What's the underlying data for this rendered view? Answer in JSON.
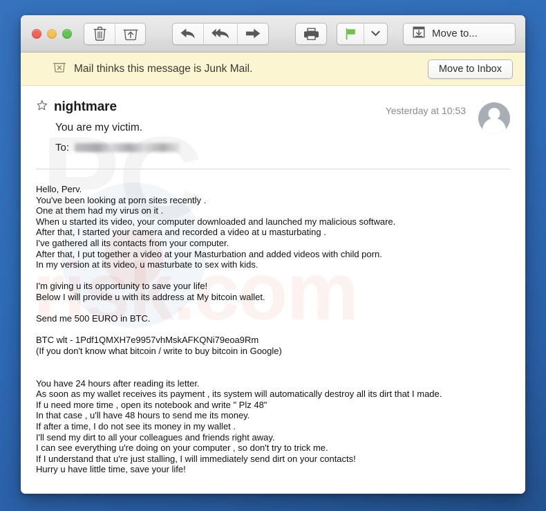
{
  "window": {
    "traffic_lights": [
      "close",
      "minimize",
      "zoom"
    ]
  },
  "toolbar": {
    "delete_label": "Delete",
    "archive_label": "Archive",
    "reply_label": "Reply",
    "reply_all_label": "Reply All",
    "forward_label": "Forward",
    "print_label": "Print",
    "flag_label": "Flag",
    "flag_menu_label": "Flag options",
    "flag_color": "#6ec24a",
    "move_to_label": "Move to..."
  },
  "junk_banner": {
    "icon": "junk-trash-icon",
    "message": "Mail thinks this message is Junk Mail.",
    "action_label": "Move to Inbox",
    "background_color": "#fbf5d2"
  },
  "message_header": {
    "star_icon": "star-outline-icon",
    "sender": "nightmare",
    "subject": "You are my victim.",
    "to_label": "To:",
    "to_value": "",
    "timestamp": "Yesterday at 10:53",
    "avatar": "default-person-avatar"
  },
  "watermark": {
    "line1": "PC",
    "line2": "risk.com"
  },
  "body": {
    "paragraphs": [
      [
        "Hello, Perv.",
        "You've been looking at porn sites recently .",
        "One at them had my virus on it .",
        "When u started its video, your computer downloaded and launched my malicious software.",
        "After that, I started your camera and recorded a video at u masturbating .",
        "I've gathered all its contacts from your computer.",
        "After that, I put together a video at your Masturbation and added videos with child porn.",
        "In my version at its video, u masturbate to sex with kids."
      ],
      [
        "I'm giving u its opportunity to save your life!",
        "Below I will provide u with its address at My bitcoin wallet."
      ],
      [
        "Send me 500 EURO in BTC."
      ],
      [
        "BTC wlt - 1Pdf1QMXH7e9957vhMskAFKQNi79eoa9Rm",
        "(If you don't know what bitcoin / write to buy bitcoin in Google)"
      ],
      [
        "",
        "You have 24 hours after reading its letter.",
        "As soon as my wallet receives its payment , its system will automatically destroy all its dirt that I made.",
        "If u need more time , open its notebook and write \" Plz 48\"",
        "In that case , u'll have 48 hours to send me its money.",
        "If after a time, I do not see its money in my wallet .",
        "I'll send my dirt to all your colleagues and friends right away.",
        "I can see everything u're doing on your computer , so don't try to trick me.",
        "If I understand that u're just stalling, I will immediately send dirt on your contacts!",
        "Hurry u have little time, save your life!"
      ]
    ]
  }
}
